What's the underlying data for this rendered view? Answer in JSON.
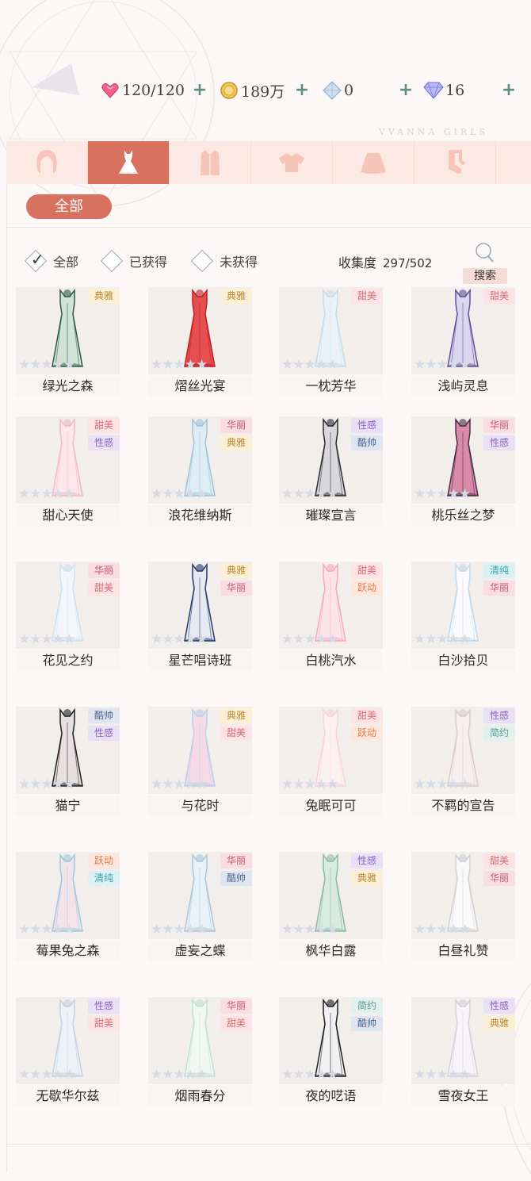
{
  "resources": {
    "stamina": {
      "icon": "heart-gem-icon",
      "value": "120/120"
    },
    "gold": {
      "icon": "gold-coin-icon",
      "value": "189万"
    },
    "crystal": {
      "icon": "crystal-icon",
      "value": "0"
    },
    "diamond": {
      "icon": "diamond-icon",
      "value": "16"
    },
    "plus_label": "+"
  },
  "brand_watermark": "VVANNA GIRLS",
  "category_tabs": [
    {
      "icon": "hair-icon",
      "active": false
    },
    {
      "icon": "dress-icon",
      "active": true
    },
    {
      "icon": "coat-icon",
      "active": false
    },
    {
      "icon": "top-icon",
      "active": false
    },
    {
      "icon": "skirt-icon",
      "active": false
    },
    {
      "icon": "socks-icon",
      "active": false
    }
  ],
  "subfilter": {
    "label": "全部"
  },
  "filters": [
    {
      "label": "全部",
      "checked": true
    },
    {
      "label": "已获得",
      "checked": false
    },
    {
      "label": "未获得",
      "checked": false
    }
  ],
  "collection": {
    "label": "收集度",
    "value": "297/502"
  },
  "search_label": "搜索",
  "tag_colors": {
    "典雅": {
      "bg": "#fbf0d6",
      "fg": "#b98a33"
    },
    "甜美": {
      "bg": "#fde3e3",
      "fg": "#d66b77"
    },
    "华丽": {
      "bg": "#f9dde2",
      "fg": "#c2566c"
    },
    "性感": {
      "bg": "#e9e0f6",
      "fg": "#8a62c0"
    },
    "酷帅": {
      "bg": "#dfe6f2",
      "fg": "#4c628c"
    },
    "跃动": {
      "bg": "#fde7dc",
      "fg": "#e07b4a"
    },
    "清纯": {
      "bg": "#dcf1f3",
      "fg": "#3aa3b0"
    },
    "简约": {
      "bg": "#e2f0ee",
      "fg": "#5a9a91"
    }
  },
  "items": [
    {
      "name": "绿光之森",
      "tags": [
        "典雅"
      ],
      "colors": [
        "#2f5a48",
        "#cfe3d6"
      ]
    },
    {
      "name": "熠丝光宴",
      "tags": [
        "典雅"
      ],
      "colors": [
        "#c21c24",
        "#e45050"
      ]
    },
    {
      "name": "一枕芳华",
      "tags": [
        "甜美"
      ],
      "colors": [
        "#c4dce9",
        "#eaf2f7"
      ]
    },
    {
      "name": "浅屿灵息",
      "tags": [
        "甜美"
      ],
      "colors": [
        "#5e4f9a",
        "#d9d6ee"
      ]
    },
    {
      "name": "甜心天使",
      "tags": [
        "甜美",
        "性感"
      ],
      "colors": [
        "#f2b9c8",
        "#fde6ec"
      ]
    },
    {
      "name": "浪花维纳斯",
      "tags": [
        "华丽",
        "典雅"
      ],
      "colors": [
        "#9ec3d8",
        "#dfeef5"
      ]
    },
    {
      "name": "璀璨宣言",
      "tags": [
        "性感",
        "酷帅"
      ],
      "colors": [
        "#2a2a2e",
        "#d8d8dc"
      ]
    },
    {
      "name": "桃乐丝之梦",
      "tags": [
        "华丽",
        "性感"
      ],
      "colors": [
        "#4a2a45",
        "#d98aa6"
      ]
    },
    {
      "name": "花见之约",
      "tags": [
        "华丽",
        "甜美"
      ],
      "colors": [
        "#cfe0ee",
        "#f3f7fb"
      ]
    },
    {
      "name": "星芒唱诗班",
      "tags": [
        "典雅",
        "华丽"
      ],
      "colors": [
        "#243a6b",
        "#e6e9f2"
      ]
    },
    {
      "name": "白桃汽水",
      "tags": [
        "甜美",
        "跃动"
      ],
      "colors": [
        "#f4a9c0",
        "#fde3ea"
      ]
    },
    {
      "name": "白沙拾贝",
      "tags": [
        "清纯",
        "华丽"
      ],
      "colors": [
        "#bfd8ea",
        "#fbfbfd"
      ]
    },
    {
      "name": "猫宁",
      "tags": [
        "酷帅",
        "性感"
      ],
      "colors": [
        "#1f1f22",
        "#e9dfe0"
      ]
    },
    {
      "name": "与花时",
      "tags": [
        "典雅",
        "甜美"
      ],
      "colors": [
        "#b9cfe8",
        "#f6dbe6"
      ]
    },
    {
      "name": "兔眠可可",
      "tags": [
        "甜美",
        "跃动"
      ],
      "colors": [
        "#f7d3dd",
        "#fdf1f4"
      ]
    },
    {
      "name": "不羁的宣告",
      "tags": [
        "性感",
        "简约"
      ],
      "colors": [
        "#d9c9c9",
        "#f6f0f0"
      ]
    },
    {
      "name": "莓果兔之森",
      "tags": [
        "跃动",
        "清纯"
      ],
      "colors": [
        "#9fc6df",
        "#f4e4e9"
      ]
    },
    {
      "name": "虚妄之蝶",
      "tags": [
        "华丽",
        "酷帅"
      ],
      "colors": [
        "#a9c7dc",
        "#e9f2f7"
      ]
    },
    {
      "name": "枫华白露",
      "tags": [
        "性感",
        "典雅"
      ],
      "colors": [
        "#8fb9a4",
        "#d8ebe1"
      ]
    },
    {
      "name": "白昼礼赞",
      "tags": [
        "甜美",
        "华丽"
      ],
      "colors": [
        "#cfcfd3",
        "#fafafa"
      ]
    },
    {
      "name": "无歇华尔兹",
      "tags": [
        "性感",
        "甜美"
      ],
      "colors": [
        "#c3d0e0",
        "#eef2f7"
      ]
    },
    {
      "name": "烟雨春分",
      "tags": [
        "华丽",
        "甜美"
      ],
      "colors": [
        "#bfe1d3",
        "#f1f8f4"
      ]
    },
    {
      "name": "夜的呓语",
      "tags": [
        "简约",
        "酷帅"
      ],
      "colors": [
        "#1e1e22",
        "#f1f1f1"
      ]
    },
    {
      "name": "雪夜女王",
      "tags": [
        "性感",
        "典雅"
      ],
      "colors": [
        "#d4d0da",
        "#f7f5f8"
      ]
    }
  ],
  "star_glyph": "★★★★★"
}
